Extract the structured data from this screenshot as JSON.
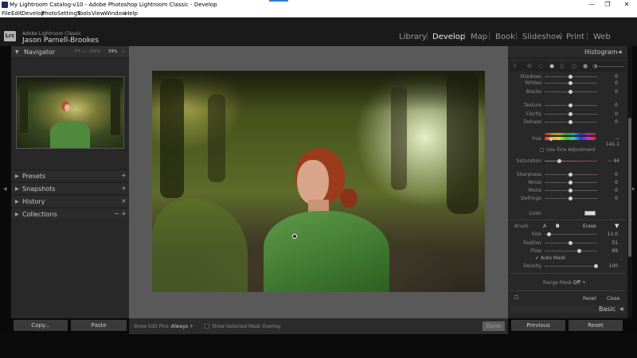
{
  "window": {
    "title": "My Lightroom Catalog-v10 - Adobe Photoshop Lightroom Classic - Develop",
    "minimize": "—",
    "maximize": "❐",
    "close": "✕"
  },
  "menu": [
    "File",
    "Edit",
    "Develop",
    "Photo",
    "Settings",
    "Tools",
    "View",
    "Window",
    "Help"
  ],
  "identity": {
    "logo": "Lrc",
    "app_name": "Adobe Lightroom Classic",
    "user_name": "Jason Parnell-Brookes"
  },
  "modules": [
    "Library",
    "Develop",
    "Map",
    "Book",
    "Slideshow",
    "Print",
    "Web"
  ],
  "active_module": "Develop",
  "left_panel": {
    "navigator": {
      "title": "Navigator",
      "fit": "FIT ÷",
      "z100": "100%",
      "z33": "33%",
      "zmore": "÷"
    },
    "sections": [
      {
        "name": "Presets",
        "action": "+"
      },
      {
        "name": "Snapshots",
        "action": "+"
      },
      {
        "name": "History",
        "action": "×"
      },
      {
        "name": "Collections",
        "action": "−  +"
      }
    ],
    "copy_button": "Copy...",
    "paste_button": "Paste"
  },
  "toolbar": {
    "show_edit_pins_label": "Show Edit Pins :",
    "show_edit_pins_value": "Always ÷",
    "mask_overlay_label": "Show Selected Mask Overlay",
    "done_button": "Done"
  },
  "right_panel": {
    "histogram_title": "Histogram",
    "basic_sliders": [
      {
        "label": "Shadows",
        "value": "0",
        "pos": 0.5
      },
      {
        "label": "Whites",
        "value": "0",
        "pos": 0.5
      },
      {
        "label": "Blacks",
        "value": "0",
        "pos": 0.5
      }
    ],
    "presence_sliders": [
      {
        "label": "Texture",
        "value": "0",
        "pos": 0.5
      },
      {
        "label": "Clarity",
        "value": "0",
        "pos": 0.5
      },
      {
        "label": "Dehaze",
        "value": "0",
        "pos": 0.5
      }
    ],
    "hue": {
      "label": "Hue",
      "value": "− 141.1",
      "pos": 0.12
    },
    "fine_adjustment": "Use Fine Adjustment",
    "saturation": {
      "label": "Saturation",
      "value": "− 44",
      "pos": 0.28
    },
    "detail_sliders": [
      {
        "label": "Sharpness",
        "value": "0",
        "pos": 0.5
      },
      {
        "label": "Noise",
        "value": "0",
        "pos": 0.5
      },
      {
        "label": "Moire",
        "value": "0",
        "pos": 0.5
      },
      {
        "label": "Defringe",
        "value": "0",
        "pos": 0.5
      }
    ],
    "color_label": "Color",
    "brush": {
      "label": "Brush :",
      "a": "A",
      "b": "B",
      "erase": "Erase",
      "arrow": "▼"
    },
    "brush_sliders": [
      {
        "label": "Size",
        "value": "11.0",
        "pos": 0.08
      },
      {
        "label": "Feather",
        "value": "51",
        "pos": 0.51
      },
      {
        "label": "Flow",
        "value": "69",
        "pos": 0.69
      }
    ],
    "auto_mask": "Auto Mask",
    "density": {
      "label": "Density",
      "value": "100",
      "pos": 1.0
    },
    "range_mask_label": "Range Mask :",
    "range_mask_value": "Off ÷",
    "reset": "Reset",
    "close": "Close",
    "basic_title": "Basic",
    "previous_button": "Previous",
    "reset_button": "Reset"
  }
}
